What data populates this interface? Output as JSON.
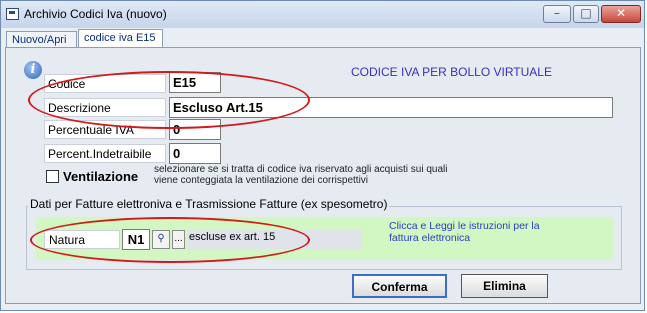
{
  "window": {
    "title": "Archivio Codici Iva (nuovo)"
  },
  "window_controls": {
    "minimize": "–",
    "maximize": "□",
    "close": "✕"
  },
  "tabs": [
    {
      "label": "Nuovo/Apri"
    },
    {
      "label": "codice iva E15"
    }
  ],
  "panel": {
    "info_icon": "i",
    "header_title": "CODICE IVA PER BOLLO VIRTUALE",
    "fields": {
      "codice_label": "Codice",
      "codice_value": "E15",
      "descrizione_label": "Descrizione",
      "descrizione_value": "Escluso Art.15",
      "percentuale_label": "Percentuale IVA",
      "percentuale_value": "0",
      "indetraibile_label": "Percent.Indetraibile",
      "indetraibile_value": "0"
    },
    "ventilazione": {
      "label": "Ventilazione",
      "description": "selezionare se si tratta di codice iva riservato agli acquisti sui quali viene conteggiata la ventilazione dei corrispettivi"
    },
    "group": {
      "title": "Dati per Fatture elettroniva e Trasmissione Fatture (ex spesometro)",
      "natura_label": "Natura",
      "natura_code": "N1",
      "natura_description": "escluse ex art. 15",
      "lookup_button": "⚲",
      "ellipsis_button": "...",
      "info_link": "Clicca e Leggi le istruzioni per la fattura elettronica"
    },
    "buttons": {
      "confirm": "Conferma",
      "delete": "Elimina"
    }
  },
  "annotation_color": "#d11a1a"
}
